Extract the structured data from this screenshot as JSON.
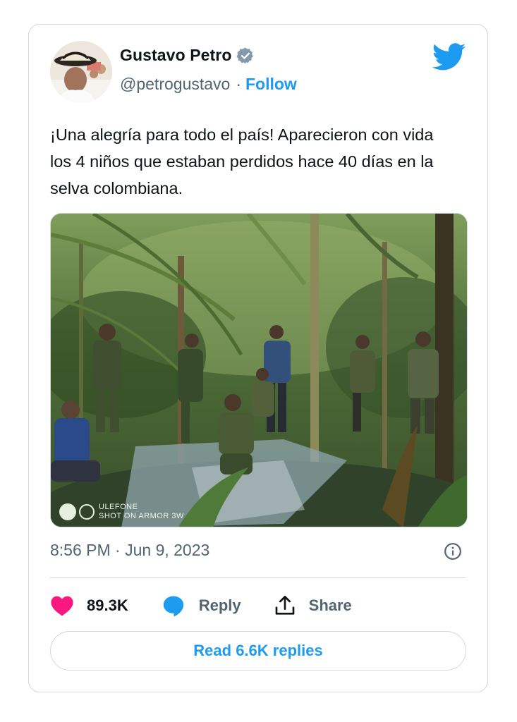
{
  "author": {
    "name": "Gustavo Petro",
    "handle": "@petrogustavo",
    "separator": "·",
    "follow_label": "Follow"
  },
  "tweet": {
    "text": "¡Una alegría para todo el país! Aparecieron con vida los 4 niños que estaban perdidos hace 40 días en la selva colombiana.",
    "timestamp": "8:56 PM · Jun 9, 2023",
    "photo_watermark": [
      "ULEFONE",
      "SHOT ON ARMOR 3W"
    ]
  },
  "actions": {
    "likes": "89.3K",
    "reply": "Reply",
    "share": "Share"
  },
  "read_replies": "Read 6.6K replies",
  "colors": {
    "accent": "#1d9bf0",
    "heart": "#f91880",
    "muted": "#536471",
    "border": "#cfd9de"
  }
}
